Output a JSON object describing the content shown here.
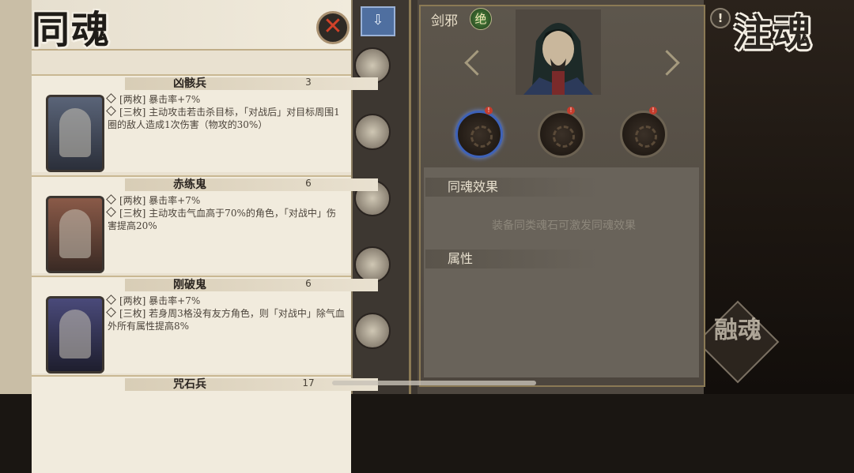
{
  "left_panel": {
    "title": "同魂",
    "close_icon": "close-icon",
    "cards": [
      {
        "name": "凶骸兵",
        "count": "3",
        "badge": "",
        "effects": [
          "[两枚] 暴击率+7%",
          "[三枚] 主动攻击若击杀目标，「对战后」对目标周围1圈的敌人造成1次伤害（物攻的30%）"
        ]
      },
      {
        "name": "赤练鬼",
        "count": "6",
        "badge": "",
        "effects": [
          "[两枚] 暴击率+7%",
          "[三枚] 主动攻击气血高于70%的角色，「对战中」伤害提高20%"
        ]
      },
      {
        "name": "刚破鬼",
        "count": "6",
        "badge": "",
        "effects": [
          "[两枚] 暴击率+7%",
          "[三枚] 若身周3格没有友方角色，则「对战中」除气血外所有属性提高8%"
        ]
      },
      {
        "name": "咒石兵",
        "count": "17",
        "badge": "",
        "effects": []
      }
    ]
  },
  "middle_panel": {
    "shikigami_name": "剑邪",
    "rarity": "绝",
    "slot_alert": "!",
    "set_effect_title": "同魂效果",
    "set_effect_hint": "装备同类魂石可激发同魂效果",
    "attributes_title": "属性"
  },
  "right_panel": {
    "title": "注魂",
    "info_label": "!",
    "fuse_label": "融魂"
  },
  "strip": {
    "filter_icon": "arrow-down-icon"
  },
  "colors": {
    "accent": "#3e62b8",
    "alert": "#c43c2c",
    "close": "#d24229"
  }
}
